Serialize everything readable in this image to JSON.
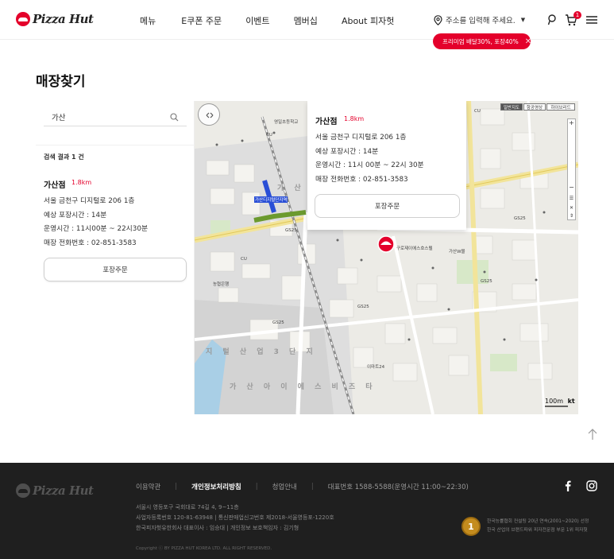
{
  "header": {
    "logo_text": "Pizza Hut",
    "nav": [
      "메뉴",
      "E쿠폰 주문",
      "이벤트",
      "멤버십",
      "About 피자헛"
    ],
    "address_placeholder": "주소를 입력해 주세요.",
    "cart_count": "1",
    "promo_text": "프리미엄 배달30%, 포장40%"
  },
  "page": {
    "title": "매장찾기"
  },
  "search": {
    "value": "가산"
  },
  "results": {
    "count_label": "검색 결과 1 건",
    "store": {
      "name": "가산점",
      "distance": "1.8km",
      "address": "서울 금천구 디지털로 206 1층",
      "pickup_time": "예상 포장시간 : 14분",
      "hours": "운영시간 : 11시00분 ~ 22시30분",
      "phone": "매장 전화번호 : 02-851-3583",
      "order_button": "포장주문"
    }
  },
  "map": {
    "popup": {
      "name": "가산점",
      "distance": "1.8km",
      "address": "서울 금천구 디지털로 206 1층",
      "pickup_time": "예상 포장시간 : 14분",
      "hours": "운영시간 : 11시 00분 ~ 22시 30분",
      "phone": "매장 전화번호 : 02-851-3583",
      "order_button": "포장주문"
    },
    "type_buttons": [
      "일반지도",
      "항공영상",
      "하이브리드"
    ],
    "scale": "100m",
    "brand": "kt",
    "labels": {
      "station": "가산디지털단지역",
      "district_1": "지 털 산 업 3 단 지",
      "district_2": "가 산 아 이 에 스 비 즈 타",
      "road_1": "가 산",
      "store_pin_label": "구로제이에스호스텔",
      "gs25": "GS25",
      "cu": "CU",
      "school": "영일초등학교",
      "bank": "농협은행",
      "market": "이마트24",
      "mall": "가산W몰"
    }
  },
  "footer": {
    "logo_text": "Pizza Hut",
    "links": [
      "이용약관",
      "개인정보처리방침",
      "청업안내",
      "대표번호 1588-5588(운영시간 11:00~22:30)"
    ],
    "lines": [
      "서울시 영등포구 국회대로 74길 4, 9~11층",
      "사업자등록번호 120-81-63948  |  통신판매업신고번호 제2018-서울영등포-1220호",
      "한국피자헛유한회사 대표이사 : 임승대  |  개인정보 보호책임자 : 김기형"
    ],
    "copyright": "Copyright ⓒ BY PIZZA HUT KOREA LTD. ALL RIGHT RESERVED.",
    "award_number": "1",
    "award_lines": [
      "한국능률협회 컨설팅 20년 연속(2001~2020) 선정",
      "한국 산업의 브랜드파워 피자전문점 부문 1위 피자헛"
    ]
  },
  "colors": {
    "brand_red": "#e4002b",
    "footer_bg": "#1f1f1f"
  }
}
